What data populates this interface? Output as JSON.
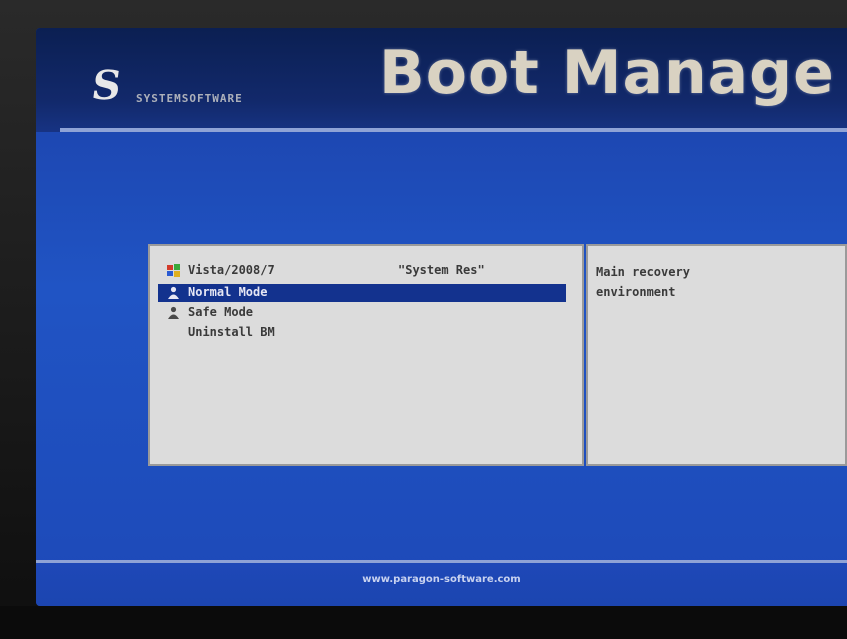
{
  "header": {
    "logo_glyph": "S",
    "logo_wordmark": "SYSTEMSOFTWARE",
    "title": "Boot Manage"
  },
  "menu": {
    "items": [
      {
        "icon": "windows-flag-icon",
        "label": "Vista/2008/7",
        "tag": "\"System Res\""
      },
      {
        "icon": "user-icon",
        "label": "Normal Mode",
        "tag": "",
        "selected": true
      },
      {
        "icon": "user-icon",
        "label": "Safe Mode",
        "tag": ""
      },
      {
        "icon": "",
        "label": "Uninstall BM",
        "tag": ""
      }
    ]
  },
  "description": {
    "text": "Main recovery\nenvironment"
  },
  "footer": {
    "url": "www.paragon-software.com"
  },
  "colors": {
    "screen_blue": "#2054c4",
    "header_navy": "#0b1f52",
    "selection": "#13328e",
    "panel_bg": "#dcdcdc"
  }
}
